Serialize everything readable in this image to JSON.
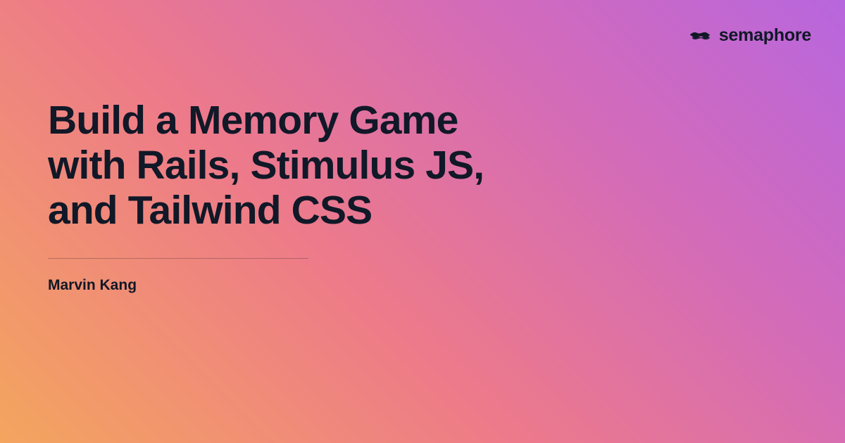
{
  "brand": {
    "name": "semaphore"
  },
  "post": {
    "title": "Build a Memory Game with Rails, Stimulus JS, and Tailwind CSS",
    "author": "Marvin Kang"
  }
}
